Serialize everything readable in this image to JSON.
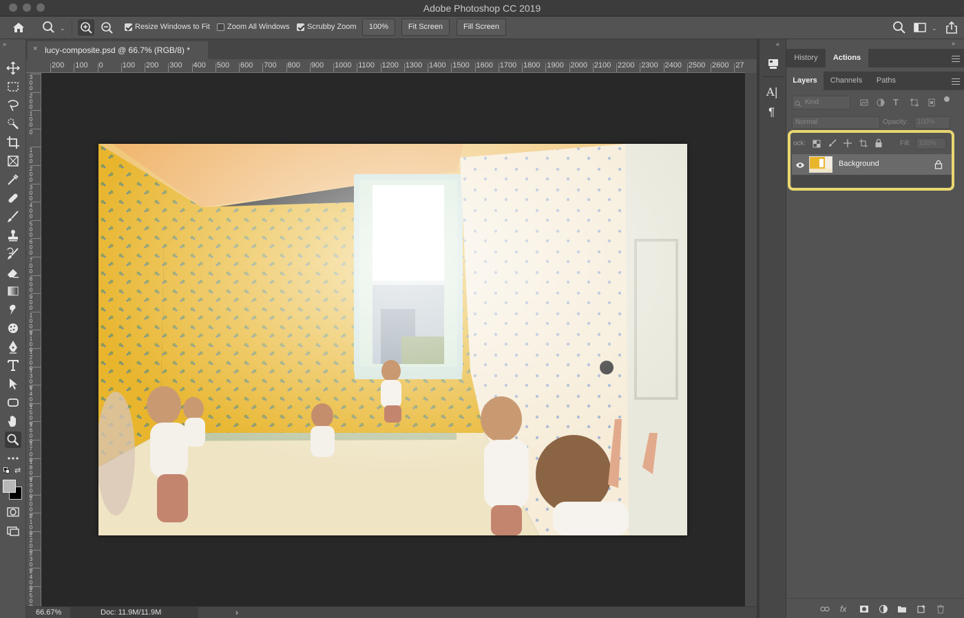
{
  "window": {
    "title": "Adobe Photoshop CC 2019"
  },
  "options": {
    "resize_label": "Resize Windows to Fit",
    "resize_checked": true,
    "zoom_all_label": "Zoom All Windows",
    "zoom_all_checked": false,
    "scrubby_label": "Scrubby Zoom",
    "scrubby_checked": true,
    "zoom_value": "100%",
    "fit_screen": "Fit Screen",
    "fill_screen": "Fill Screen"
  },
  "tools": [
    "move-tool",
    "marquee-tool",
    "lasso-tool",
    "quick-select-tool",
    "crop-tool",
    "frame-tool",
    "eyedropper-tool",
    "healing-tool",
    "brush-tool",
    "stamp-tool",
    "history-brush-tool",
    "eraser-tool",
    "gradient-tool",
    "smudge-tool",
    "dodge-tool",
    "pen-tool",
    "type-tool",
    "path-select-tool",
    "shape-tool",
    "hand-tool",
    "zoom-tool",
    "more-tools"
  ],
  "document": {
    "tab_title": "lucy-composite.psd @ 66.7% (RGB/8) *",
    "close_glyph": "×"
  },
  "ruler": {
    "h_labels": [
      "200",
      "100",
      "0",
      "100",
      "200",
      "300",
      "400",
      "500",
      "600",
      "700",
      "800",
      "900",
      "1000",
      "1100",
      "1200",
      "1300",
      "1400",
      "1500",
      "1600",
      "1700",
      "1800",
      "1900",
      "2000",
      "2100",
      "2200",
      "2300",
      "2400",
      "2500",
      "2600",
      "27"
    ],
    "v_labels": [
      "3\n0\n0",
      "2\n0\n0",
      "1\n0\n0",
      "0",
      "1\n0\n0",
      "2\n0\n0",
      "3\n0\n0",
      "4\n0\n0",
      "5\n0\n0",
      "6\n0\n0",
      "7\n0\n0",
      "8\n0\n0",
      "9\n0\n0",
      "1\n0\n0\n0",
      "1\n1\n0\n0",
      "1\n2\n0\n0",
      "1\n3\n0\n0",
      "1\n4\n0\n0",
      "1\n5\n0\n0",
      "1\n6\n0\n0",
      "1\n7\n0\n0",
      "1\n8\n0\n0",
      "1\n9\n0\n0",
      "2\n0\n0\n0",
      "2\n1\n0\n0",
      "2\n2\n0\n0",
      "2\n3\n0\n0",
      "2\n4\n0\n0",
      "2\n5\n0\n0"
    ]
  },
  "status": {
    "zoom": "66.67%",
    "doc": "Doc: 11.9M/11.9M",
    "arrow": "›"
  },
  "panels": {
    "history_tab": "History",
    "actions_tab": "Actions",
    "layers_tab": "Layers",
    "channels_tab": "Channels",
    "paths_tab": "Paths",
    "kind_placeholder": "Kind",
    "blend_mode": "Normal",
    "opacity_label": "Opacity:",
    "opacity_value": "100%",
    "lock_label": "ock:",
    "fill_label": "Fill:",
    "fill_value": "100%",
    "layers": [
      {
        "name": "Background",
        "visible": true,
        "locked": true
      }
    ]
  },
  "colors": {
    "highlight": "#e9d870",
    "wall": "#e6b52c",
    "floor": "#efe4c4"
  }
}
